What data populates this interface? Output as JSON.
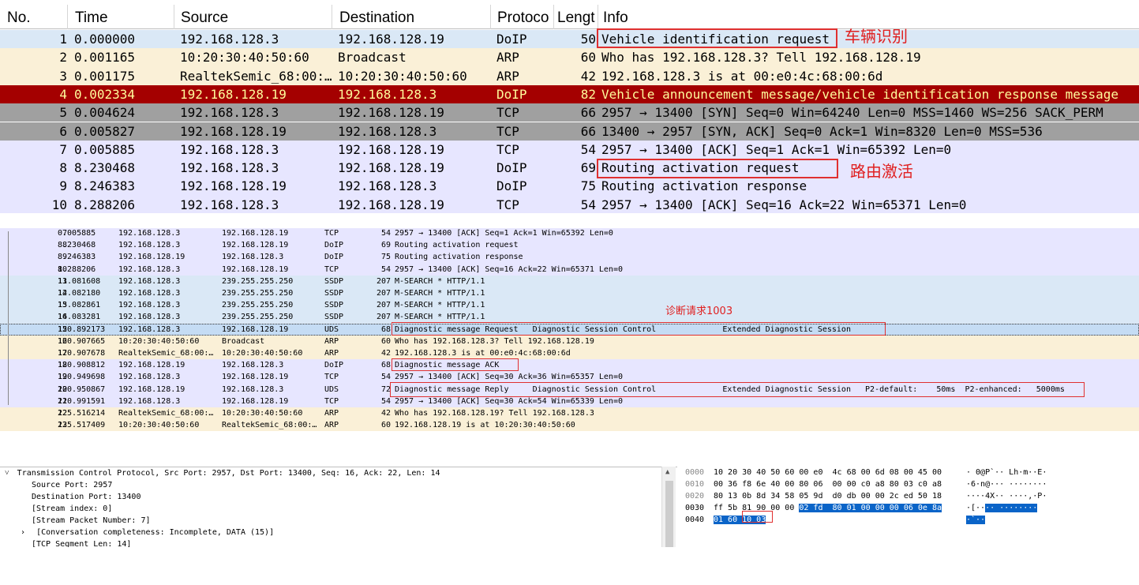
{
  "top_list": {
    "columns": [
      "No.",
      "Time",
      "Source",
      "Destination",
      "Protoco",
      "Lengt",
      "Info"
    ],
    "rows": [
      {
        "no": "1",
        "time": "0.000000",
        "src": "192.168.128.3",
        "dst": "192.168.128.19",
        "proto": "DoIP",
        "len": "50",
        "info": "Vehicle identification request",
        "color": "blue"
      },
      {
        "no": "2",
        "time": "0.001165",
        "src": "10:20:30:40:50:60",
        "dst": "Broadcast",
        "proto": "ARP",
        "len": "60",
        "info": "Who has 192.168.128.3? Tell 192.168.128.19",
        "color": "tan"
      },
      {
        "no": "3",
        "time": "0.001175",
        "src": "RealtekSemic_68:00:…",
        "dst": "10:20:30:40:50:60",
        "proto": "ARP",
        "len": "42",
        "info": "192.168.128.3 is at 00:e0:4c:68:00:6d",
        "color": "tan"
      },
      {
        "no": "4",
        "time": "0.002334",
        "src": "192.168.128.19",
        "dst": "192.168.128.3",
        "proto": "DoIP",
        "len": "82",
        "info": "Vehicle announcement message/vehicle identification response message",
        "color": "red"
      },
      {
        "no": "5",
        "time": "0.004624",
        "src": "192.168.128.3",
        "dst": "192.168.128.19",
        "proto": "TCP",
        "len": "66",
        "info": "2957 → 13400 [SYN] Seq=0 Win=64240 Len=0 MSS=1460 WS=256 SACK_PERM",
        "color": "gray"
      },
      {
        "no": "6",
        "time": "0.005827",
        "src": "192.168.128.19",
        "dst": "192.168.128.3",
        "proto": "TCP",
        "len": "66",
        "info": "13400 → 2957 [SYN, ACK] Seq=0 Ack=1 Win=8320 Len=0 MSS=536",
        "color": "gray"
      },
      {
        "no": "7",
        "time": "0.005885",
        "src": "192.168.128.3",
        "dst": "192.168.128.19",
        "proto": "TCP",
        "len": "54",
        "info": "2957 → 13400 [ACK] Seq=1 Ack=1 Win=65392 Len=0",
        "color": "light"
      },
      {
        "no": "8",
        "time": "8.230468",
        "src": "192.168.128.3",
        "dst": "192.168.128.19",
        "proto": "DoIP",
        "len": "69",
        "info": "Routing activation request",
        "color": "light"
      },
      {
        "no": "9",
        "time": "8.246383",
        "src": "192.168.128.19",
        "dst": "192.168.128.3",
        "proto": "DoIP",
        "len": "75",
        "info": "Routing activation response",
        "color": "light"
      },
      {
        "no": "10",
        "time": "8.288206",
        "src": "192.168.128.3",
        "dst": "192.168.128.19",
        "proto": "TCP",
        "len": "54",
        "info": "2957 → 13400 [ACK] Seq=16 Ack=22 Win=65371 Len=0",
        "color": "light"
      }
    ],
    "annotations": {
      "vehicle_id": "车辆识别",
      "routing": "路由激活"
    }
  },
  "mid_list": {
    "rows": [
      {
        "no": "7",
        "time": "0.005885",
        "src": "192.168.128.3",
        "dst": "192.168.128.19",
        "proto": "TCP",
        "len": "54",
        "info": "2957 → 13400 [ACK] Seq=1 Ack=1 Win=65392 Len=0",
        "color": "light"
      },
      {
        "no": "8",
        "time": "8.230468",
        "src": "192.168.128.3",
        "dst": "192.168.128.19",
        "proto": "DoIP",
        "len": "69",
        "info": "Routing activation request",
        "color": "light"
      },
      {
        "no": "9",
        "time": "8.246383",
        "src": "192.168.128.19",
        "dst": "192.168.128.3",
        "proto": "DoIP",
        "len": "75",
        "info": "Routing activation response",
        "color": "light"
      },
      {
        "no": "10",
        "time": "8.288206",
        "src": "192.168.128.3",
        "dst": "192.168.128.19",
        "proto": "TCP",
        "len": "54",
        "info": "2957 → 13400 [ACK] Seq=16 Ack=22 Win=65371 Len=0",
        "color": "light"
      },
      {
        "no": "11",
        "time": "13.081608",
        "src": "192.168.128.3",
        "dst": "239.255.255.250",
        "proto": "SSDP",
        "len": "207",
        "info": "M-SEARCH * HTTP/1.1",
        "color": "blue"
      },
      {
        "no": "12",
        "time": "14.082180",
        "src": "192.168.128.3",
        "dst": "239.255.255.250",
        "proto": "SSDP",
        "len": "207",
        "info": "M-SEARCH * HTTP/1.1",
        "color": "blue"
      },
      {
        "no": "13",
        "time": "15.082861",
        "src": "192.168.128.3",
        "dst": "239.255.255.250",
        "proto": "SSDP",
        "len": "207",
        "info": "M-SEARCH * HTTP/1.1",
        "color": "blue"
      },
      {
        "no": "14",
        "time": "16.083281",
        "src": "192.168.128.3",
        "dst": "239.255.255.250",
        "proto": "SSDP",
        "len": "207",
        "info": "M-SEARCH * HTTP/1.1",
        "color": "blue"
      },
      {
        "no": "15",
        "time": "120.892173",
        "src": "192.168.128.3",
        "dst": "192.168.128.19",
        "proto": "UDS",
        "len": "68",
        "info": "Diagnostic message Request   Diagnostic Session Control              Extended Diagnostic Session",
        "color": "sel"
      },
      {
        "no": "16",
        "time": "120.907665",
        "src": "10:20:30:40:50:60",
        "dst": "Broadcast",
        "proto": "ARP",
        "len": "60",
        "info": "Who has 192.168.128.3? Tell 192.168.128.19",
        "color": "tan"
      },
      {
        "no": "17",
        "time": "120.907678",
        "src": "RealtekSemic_68:00:…",
        "dst": "10:20:30:40:50:60",
        "proto": "ARP",
        "len": "42",
        "info": "192.168.128.3 is at 00:e0:4c:68:00:6d",
        "color": "tan"
      },
      {
        "no": "18",
        "time": "120.908812",
        "src": "192.168.128.19",
        "dst": "192.168.128.3",
        "proto": "DoIP",
        "len": "68",
        "info": "Diagnostic message ACK",
        "color": "light"
      },
      {
        "no": "19",
        "time": "120.949698",
        "src": "192.168.128.3",
        "dst": "192.168.128.19",
        "proto": "TCP",
        "len": "54",
        "info": "2957 → 13400 [ACK] Seq=30 Ack=36 Win=65357 Len=0",
        "color": "light"
      },
      {
        "no": "20",
        "time": "120.950867",
        "src": "192.168.128.19",
        "dst": "192.168.128.3",
        "proto": "UDS",
        "len": "72",
        "info": "Diagnostic message Reply     Diagnostic Session Control              Extended Diagnostic Session   P2-default:    50ms  P2-enhanced:   5000ms",
        "color": "light"
      },
      {
        "no": "21",
        "time": "120.991591",
        "src": "192.168.128.3",
        "dst": "192.168.128.19",
        "proto": "TCP",
        "len": "54",
        "info": "2957 → 13400 [ACK] Seq=30 Ack=54 Win=65339 Len=0",
        "color": "light"
      },
      {
        "no": "22",
        "time": "125.516214",
        "src": "RealtekSemic_68:00:…",
        "dst": "10:20:30:40:50:60",
        "proto": "ARP",
        "len": "42",
        "info": "Who has 192.168.128.19? Tell 192.168.128.3",
        "color": "tan"
      },
      {
        "no": "23",
        "time": "125.517409",
        "src": "10:20:30:40:50:60",
        "dst": "RealtekSemic_68:00:…",
        "proto": "ARP",
        "len": "60",
        "info": "192.168.128.19 is at 10:20:30:40:50:60",
        "color": "tan"
      }
    ],
    "annotation": "诊断请求1003"
  },
  "details": {
    "tcp_header": "Transmission Control Protocol, Src Port: 2957, Dst Port: 13400, Seq: 16, Ack: 22, Len: 14",
    "source_port": "Source Port: 2957",
    "dest_port": "Destination Port: 13400",
    "stream_index": "[Stream index: 0]",
    "stream_packet": "[Stream Packet Number: 7]",
    "conversation": "[Conversation completeness: Incomplete, DATA (15)]",
    "segment_len": "[TCP Segment Len: 14]"
  },
  "hex": {
    "offsets": [
      "0000",
      "0010",
      "0020",
      "0030",
      "0040"
    ],
    "row0": "10 20 30 40 50 60 00 e0  4c 68 00 6d 08 00 45 00",
    "row1": "00 36 f8 6e 40 00 80 06  00 00 c0 a8 80 03 c0 a8",
    "row2": "80 13 0b 8d 34 58 05 9d  d0 db 00 00 2c ed 50 18",
    "row3a": "ff 5b 81 90 00 00 ",
    "row3b": "02 fd  80 01 00 00 00 06 0e 8a",
    "row4a": "01 60 ",
    "row4b": "10 03",
    "asc0": "· 0@P`·· Lh·m··E·",
    "asc1": "·6·n@··· ········",
    "asc2": "····4X·· ····,·P·",
    "asc3a": "·[··",
    "asc3b": "·· ········",
    "asc4": "·`··"
  },
  "colors": {
    "row_light": "#e7e6ff",
    "row_blue": "#dae8f6",
    "row_tan": "#faf0d7",
    "row_red": "#a40000",
    "row_gray": "#a0a0a0",
    "highlight": "#e03030",
    "hex_select": "#0a64c8"
  }
}
